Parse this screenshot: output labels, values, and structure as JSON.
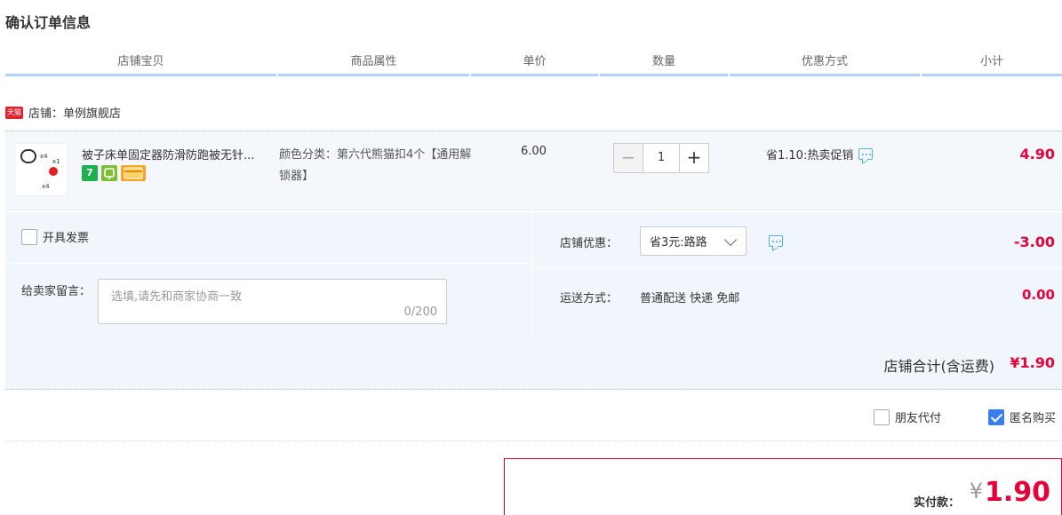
{
  "page": {
    "title": "确认订单信息"
  },
  "columns": [
    "店铺宝贝",
    "商品属性",
    "单价",
    "数量",
    "优惠方式",
    "小计"
  ],
  "shop": {
    "badge": "天猫",
    "label": "店铺：单例旗舰店"
  },
  "item": {
    "title": "被子床单固定器防滑防跑被无针...",
    "thumbnail_labels": [
      "x4",
      "x1",
      "x4"
    ],
    "badges": [
      {
        "icon": "seven-day-return-icon",
        "text": "7",
        "color": "#1eb04f"
      },
      {
        "icon": "shield-guarantee-icon",
        "text": "",
        "color": "#7dbe36"
      },
      {
        "icon": "credit-card-icon",
        "text": "",
        "color": "#f5a623"
      }
    ],
    "attr": "颜色分类：第六代熊猫扣4个【通用解锁器】",
    "price": "6.00",
    "quantity": "1",
    "promo": "省1.10:热卖促销",
    "subtotal": "4.90"
  },
  "extras": {
    "invoice_label": "开具发票",
    "message_label": "给卖家留言：",
    "message_placeholder": "选填,请先和商家协商一致",
    "message_count": "0/200",
    "shop_discount_label": "店铺优惠：",
    "shop_discount_value": "省3元:路路",
    "shop_discount_amount": "-3.00",
    "shipping_label": "运送方式：",
    "shipping_value": "普通配送 快递 免邮",
    "shipping_amount": "0.00"
  },
  "shop_total": {
    "label": "店铺合计(含运费)",
    "amount": "¥1.90"
  },
  "options": {
    "friend_pay": "朋友代付",
    "anonymous": "匿名购买",
    "anonymous_checked": true
  },
  "payment": {
    "label": "实付款：",
    "currency": "¥",
    "amount": "1.90"
  },
  "colors": {
    "accent_red": "#e4003a",
    "header_line": "#b2d1ff",
    "panel_bg": "#f1f6fc",
    "checkbox_blue": "#3a7ef0"
  }
}
